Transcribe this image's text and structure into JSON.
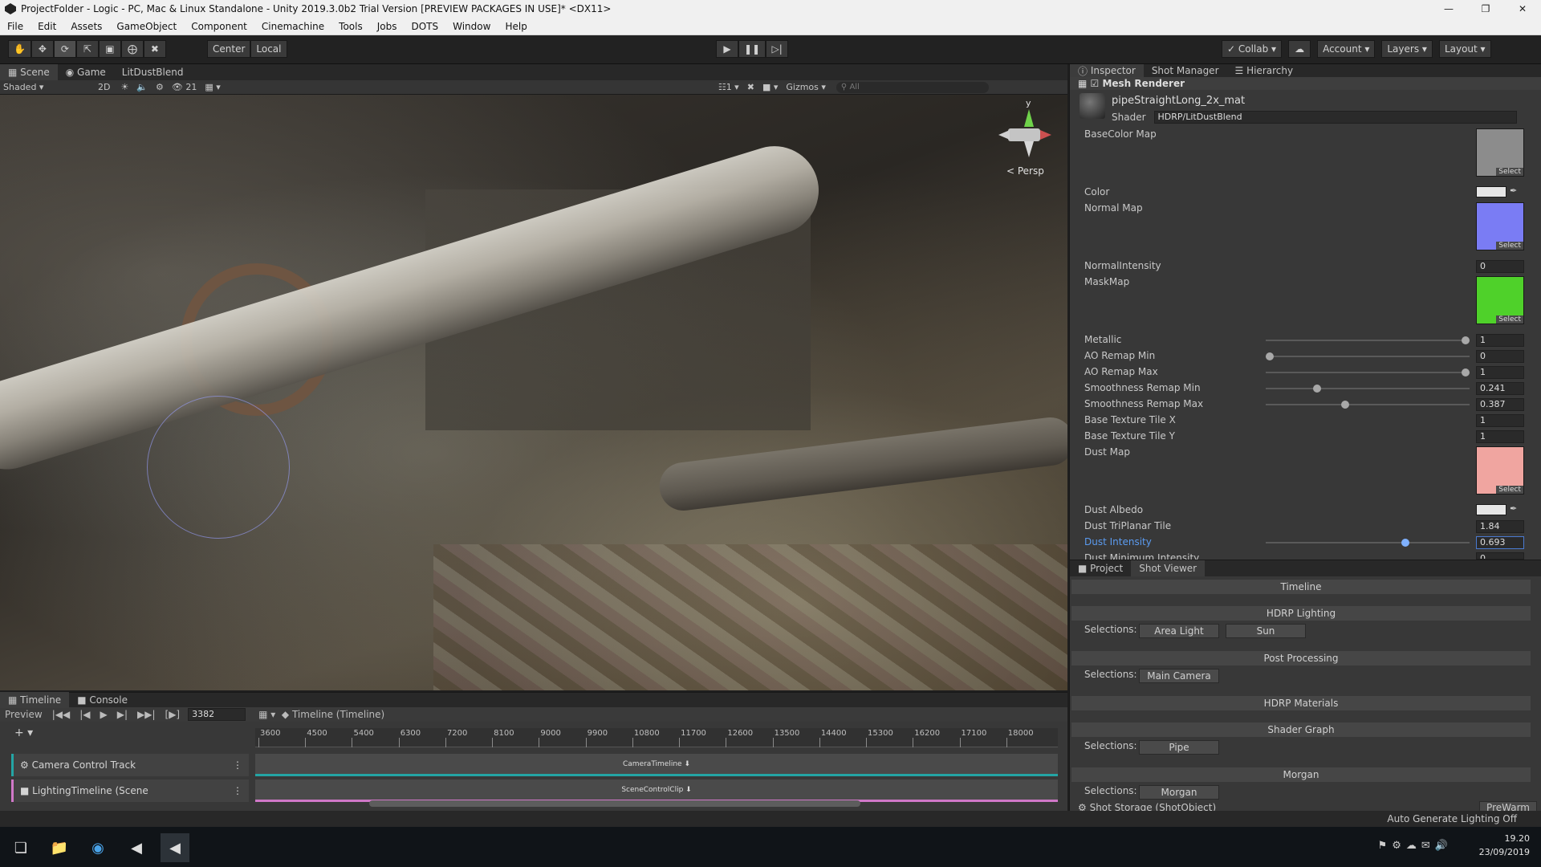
{
  "window": {
    "title": "ProjectFolder - Logic - PC, Mac & Linux Standalone - Unity 2019.3.0b2 Trial Version [PREVIEW PACKAGES IN USE]* <DX11>"
  },
  "menu": [
    "File",
    "Edit",
    "Assets",
    "GameObject",
    "Component",
    "Cinemachine",
    "Tools",
    "Jobs",
    "DOTS",
    "Window",
    "Help"
  ],
  "toolbar": {
    "pivot": "Center",
    "space": "Local",
    "collab": "Collab",
    "account": "Account",
    "layers": "Layers",
    "layout": "Layout"
  },
  "scene": {
    "tabs": [
      "Scene",
      "Game",
      "LitDustBlend"
    ],
    "shading": "Shaded",
    "mode_2d": "2D",
    "hidden_count": "21",
    "gizmos": "Gizmos",
    "search_placeholder": "All",
    "layer_count": "1",
    "axis_y": "y",
    "projection": "< Persp"
  },
  "inspector": {
    "tabs": [
      "Inspector",
      "Shot Manager",
      "Hierarchy"
    ],
    "component": "Mesh Renderer",
    "material": "pipeStraightLong_2x_mat",
    "shader_label": "Shader",
    "shader": "HDRP/LitDustBlend",
    "select_label": "Select",
    "properties": {
      "basecolor_map": "BaseColor Map",
      "color": "Color",
      "normal_map": "Normal Map",
      "normal_intensity": "NormalIntensity",
      "normal_intensity_val": "0",
      "mask_map": "MaskMap",
      "metallic": "Metallic",
      "metallic_val": "1",
      "ao_min": "AO Remap Min",
      "ao_min_val": "0",
      "ao_max": "AO Remap Max",
      "ao_max_val": "1",
      "smooth_min": "Smoothness Remap Min",
      "smooth_min_val": "0.241",
      "smooth_max": "Smoothness Remap Max",
      "smooth_max_val": "0.387",
      "tile_x": "Base Texture Tile X",
      "tile_x_val": "1",
      "tile_y": "Base Texture Tile Y",
      "tile_y_val": "1",
      "dust_map": "Dust Map",
      "dust_albedo": "Dust Albedo",
      "dust_triplanar": "Dust TriPlanar Tile",
      "dust_triplanar_val": "1.84",
      "dust_intensity": "Dust Intensity",
      "dust_intensity_val": "0.693",
      "dust_min": "Dust Minimum Intensity",
      "dust_min_val": "0"
    },
    "slider_levels": {
      "metallic": 1.0,
      "ao_min": 0.0,
      "ao_max": 1.0,
      "smooth_min": 0.241,
      "smooth_max": 0.387,
      "dust_intensity": 0.693
    },
    "colors": {
      "basecolor_map": "#8c8c8c",
      "normal_map": "#7a7cf4",
      "mask_map": "#4fd12a",
      "dust_map": "#f0a5a0"
    }
  },
  "shot_viewer": {
    "tabs": [
      "Project",
      "Shot Viewer"
    ],
    "selections_label": "Selections:",
    "sections": {
      "timeline": "Timeline",
      "hdrp_lighting": "HDRP Lighting",
      "post_processing": "Post Processing",
      "hdrp_materials": "HDRP Materials",
      "shader_graph": "Shader Graph",
      "morgan": "Morgan"
    },
    "buttons": {
      "area_light": "Area Light",
      "sun": "Sun",
      "main_camera": "Main Camera",
      "pipe": "Pipe",
      "morgan": "Morgan"
    },
    "storage": "Shot Storage (ShotObject)",
    "prewarm": "PreWarm"
  },
  "timeline": {
    "tabs": [
      "Timeline",
      "Console"
    ],
    "preview": "Preview",
    "frame": "3382",
    "asset": "Timeline (Timeline)",
    "ruler": [
      "3600",
      "4500",
      "5400",
      "6300",
      "7200",
      "8100",
      "9000",
      "9900",
      "10800",
      "11700",
      "12600",
      "13500",
      "14400",
      "15300",
      "16200",
      "17100",
      "18000"
    ],
    "tracks": [
      {
        "name": "Camera Control Track",
        "clip": "CameraTimeline ⬇",
        "color": "#24a5a5"
      },
      {
        "name": "LightingTimeline (Scene",
        "clip": "SceneControlClip ⬇",
        "color": "#d078c8"
      }
    ]
  },
  "status": {
    "lighting": "Auto Generate Lighting Off"
  },
  "taskbar": {
    "time": "19.20",
    "date": "23/09/2019"
  }
}
